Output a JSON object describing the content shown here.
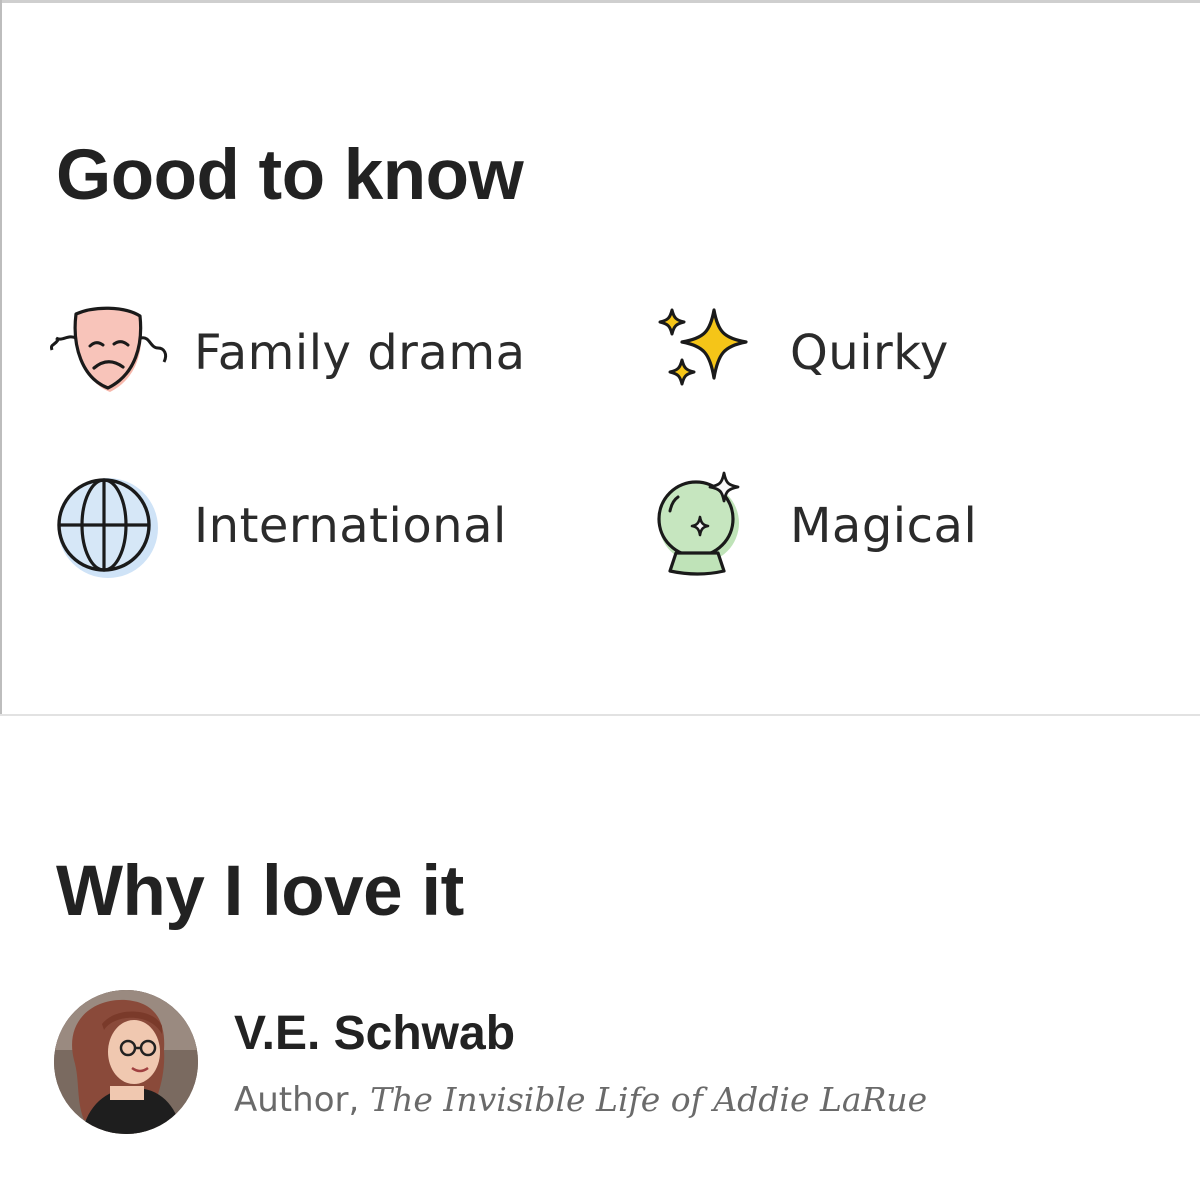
{
  "sections": {
    "good_to_know": {
      "title": "Good to know",
      "tags": [
        {
          "label": "Family drama",
          "icon": "drama-mask-icon",
          "color": "#f6b8ac"
        },
        {
          "label": "Quirky",
          "icon": "sparkles-icon",
          "color": "#f5c518"
        },
        {
          "label": "International",
          "icon": "globe-icon",
          "color": "#cfe3f7"
        },
        {
          "label": "Magical",
          "icon": "crystal-ball-icon",
          "color": "#bfe3b8"
        }
      ]
    },
    "why_i_love_it": {
      "title": "Why I love it",
      "reviewer": {
        "name": "V.E. Schwab",
        "role_prefix": "Author, ",
        "book_title": "The Invisible Life of Addie LaRue"
      }
    }
  },
  "colors": {
    "heading": "#222222",
    "label": "#2b2b2b",
    "muted": "#6a6a6a",
    "divider": "#e2e2e2"
  }
}
